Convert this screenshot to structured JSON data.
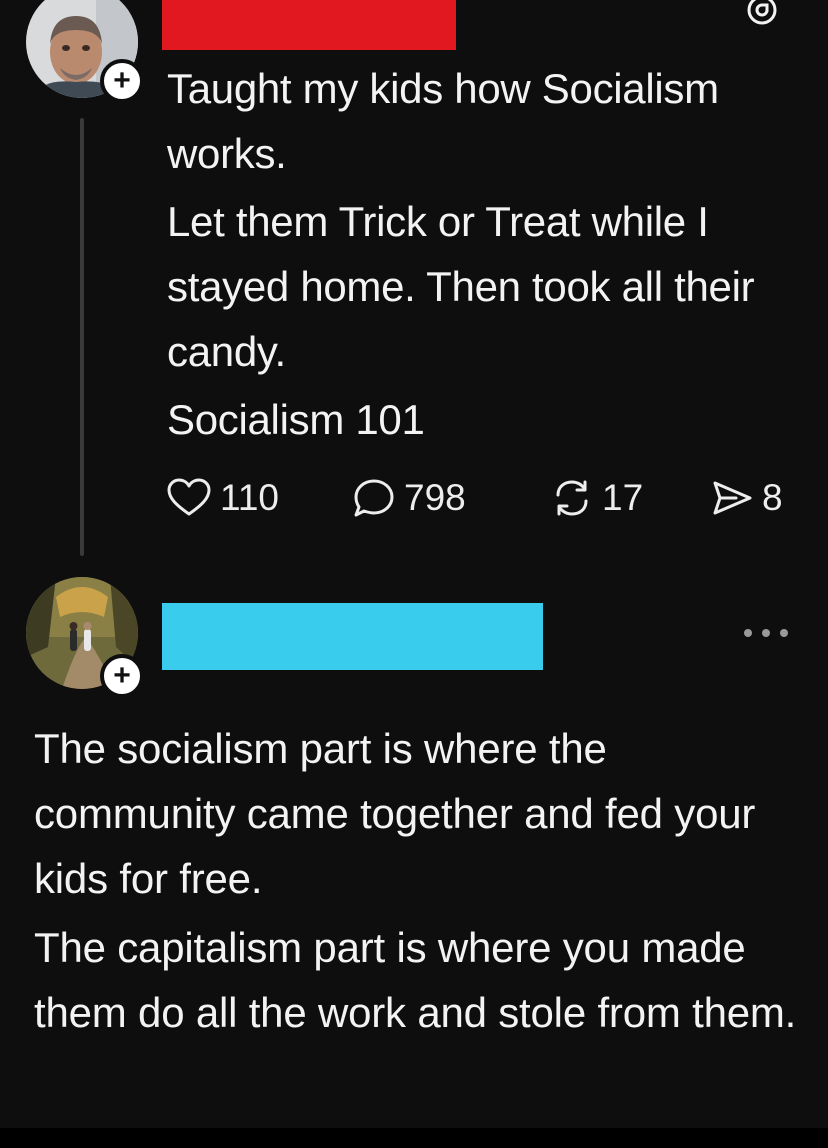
{
  "post1": {
    "avatar_icon": "user-avatar-man",
    "follow_icon": "plus-icon",
    "follow_label": "+",
    "threads_icon": "threads-logo-icon",
    "paragraphs": [
      "Taught my kids how Socialism works.",
      "Let them Trick or Treat while I stayed home. Then took all their candy.",
      "Socialism 101"
    ],
    "actions": {
      "likes": "110",
      "replies": "798",
      "reposts": "17",
      "shares": "8"
    }
  },
  "post2": {
    "avatar_icon": "user-avatar-couple-autumn-path",
    "follow_label": "+",
    "more_icon": "more-options-icon",
    "paragraphs": [
      "The socialism part is where the community came together and fed your kids for free.",
      "The capitalism part is where you made them do all the work and stole from them."
    ]
  },
  "colors": {
    "background": "#0e0e0f",
    "text": "#f3f3f3",
    "redaction_red": "#e1181f",
    "redaction_cyan": "#39ccec"
  }
}
